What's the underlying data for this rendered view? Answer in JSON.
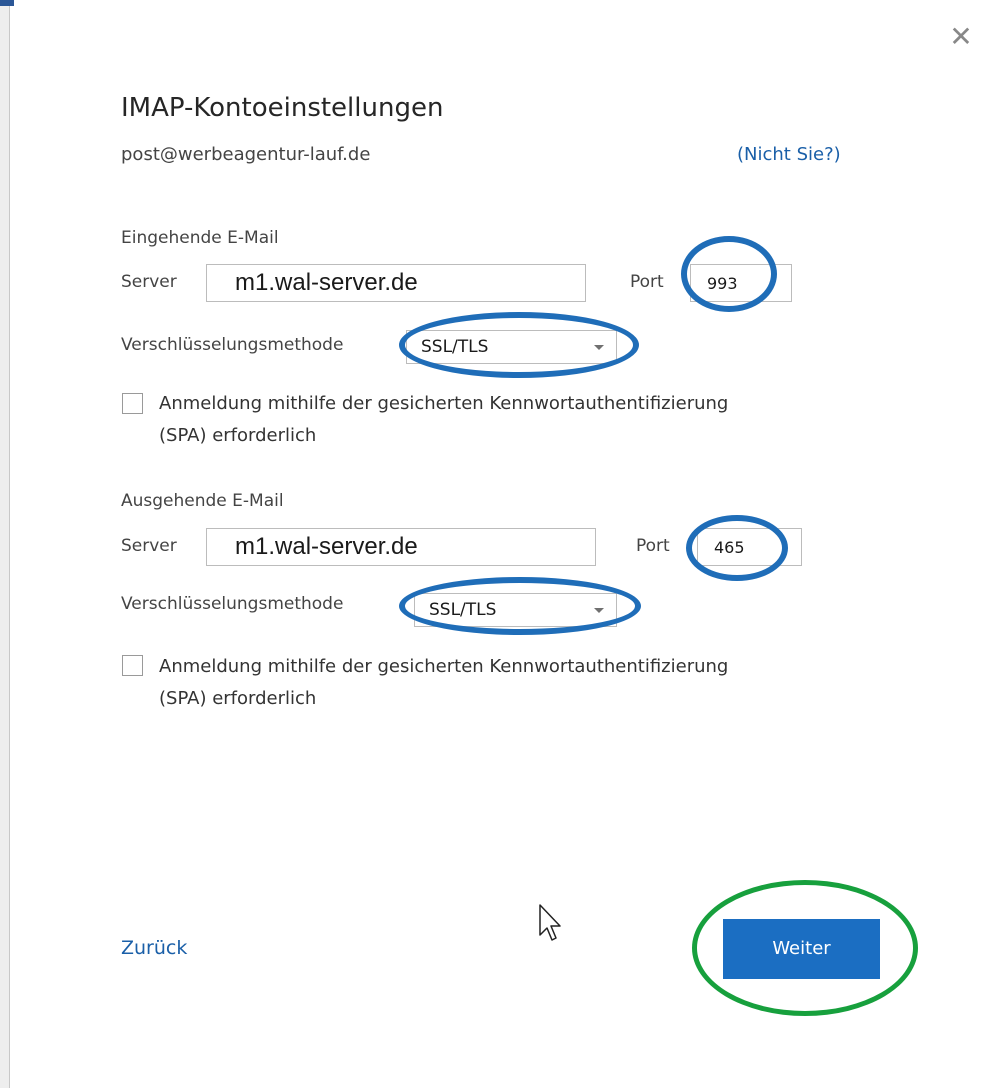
{
  "dialog": {
    "title": "IMAP-Kontoeinstellungen",
    "email": "post@werbeagentur-lauf.de",
    "not_you_link": "(Nicht Sie?)",
    "close_icon": "close-icon"
  },
  "incoming": {
    "section_label": "Eingehende E-Mail",
    "server_label": "Server",
    "server_value": "m1.wal-server.de",
    "port_label": "Port",
    "port_value": "993",
    "encryption_label": "Verschlüsselungsmethode",
    "encryption_value": "SSL/TLS",
    "spa_checked": false,
    "spa_label_line1": "Anmeldung mithilfe der gesicherten Kennwortauthentifizierung",
    "spa_label_line2": "(SPA) erforderlich"
  },
  "outgoing": {
    "section_label": "Ausgehende E-Mail",
    "server_label": "Server",
    "server_value": "m1.wal-server.de",
    "port_label": "Port",
    "port_value": "465",
    "encryption_label": "Verschlüsselungsmethode",
    "encryption_value": "SSL/TLS",
    "spa_checked": false,
    "spa_label_line1": "Anmeldung mithilfe der gesicherten Kennwortauthentifizierung",
    "spa_label_line2": "(SPA) erforderlich"
  },
  "footer": {
    "back_label": "Zurück",
    "next_label": "Weiter"
  },
  "colors": {
    "accent_blue": "#1b6ec2",
    "link_blue": "#1a5fa8",
    "annotation_blue": "#1f6db8",
    "annotation_green": "#17a03d"
  }
}
